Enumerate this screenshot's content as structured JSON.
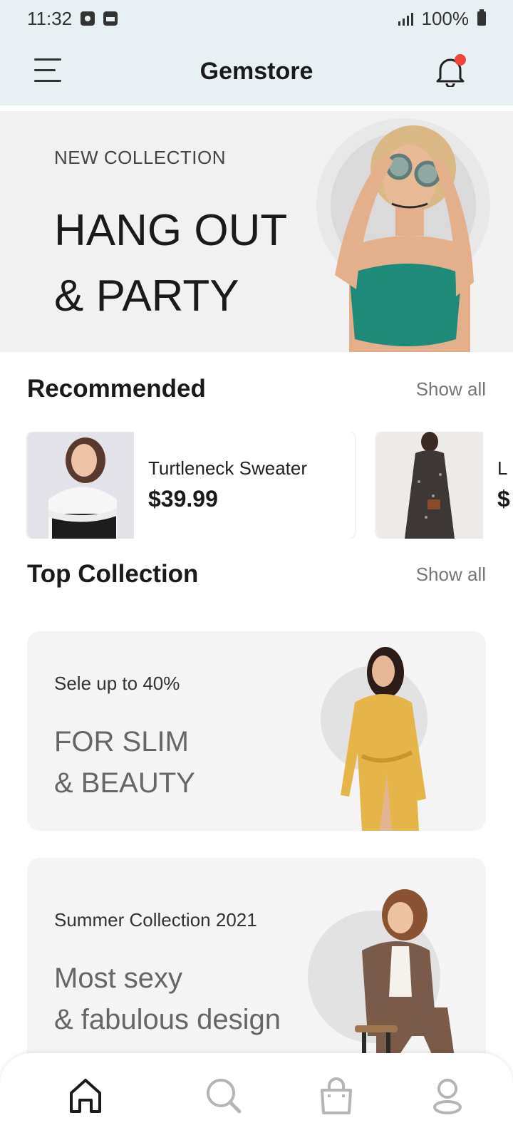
{
  "status_bar": {
    "time": "11:32",
    "battery": "100%"
  },
  "header": {
    "title": "Gemstore",
    "menu_icon": "hamburger-icon",
    "notification_icon": "bell-icon",
    "has_unread": true
  },
  "hero": {
    "kicker": "NEW COLLECTION",
    "title_line1": "HANG OUT",
    "title_line2": "& PARTY"
  },
  "recommended": {
    "title": "Recommended",
    "show_all": "Show all",
    "items": [
      {
        "name": "Turtleneck Sweater",
        "price": "$39.99"
      },
      {
        "name": "L",
        "price": "$"
      }
    ]
  },
  "top_collection": {
    "title": "Top Collection",
    "show_all": "Show all",
    "cards": [
      {
        "subtitle": "Sele up to 40%",
        "title_line1": "FOR SLIM",
        "title_line2": "& BEAUTY"
      },
      {
        "subtitle": "Summer Collection 2021",
        "title_line1": "Most sexy",
        "title_line2": "& fabulous design"
      }
    ]
  },
  "bottom_nav": {
    "items": [
      {
        "icon": "home-icon",
        "active": true
      },
      {
        "icon": "search-icon",
        "active": false
      },
      {
        "icon": "shopping-bag-icon",
        "active": false
      },
      {
        "icon": "profile-icon",
        "active": false
      }
    ]
  },
  "colors": {
    "header_bg": "#e9f0f3",
    "accent_dot": "#f0433a",
    "card_bg": "#f4f4f4",
    "inactive_icon": "#b5b5b5"
  }
}
